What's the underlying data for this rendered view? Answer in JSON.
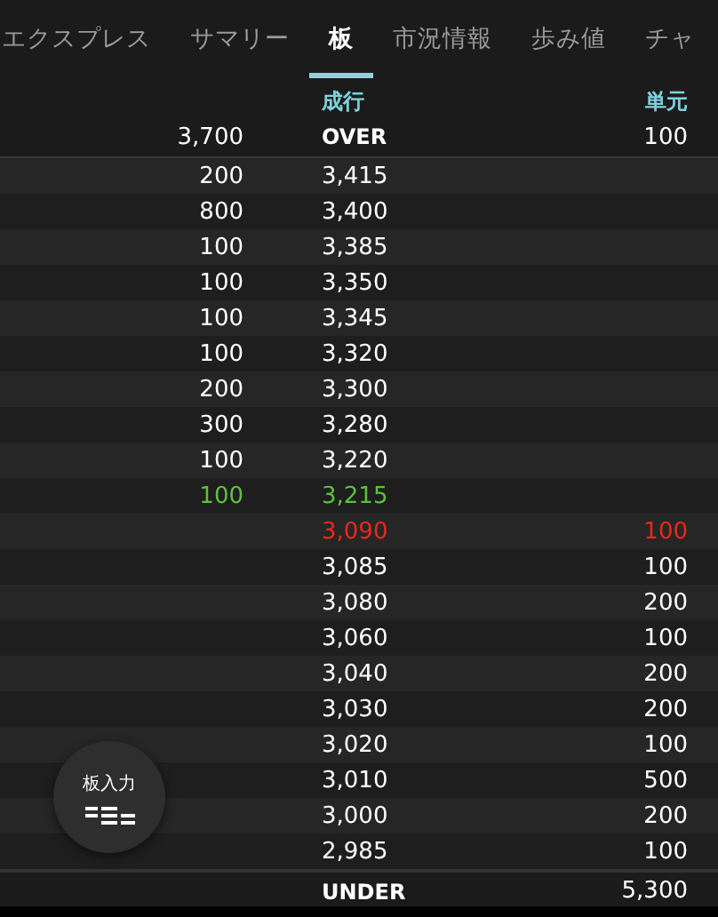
{
  "tabs": [
    {
      "label": "エクスプレス",
      "selected": false
    },
    {
      "label": "サマリー",
      "selected": false
    },
    {
      "label": "板",
      "selected": true
    },
    {
      "label": "市況情報",
      "selected": false
    },
    {
      "label": "歩み値",
      "selected": false
    },
    {
      "label": "チャ",
      "selected": false
    }
  ],
  "board": {
    "header": {
      "price": "成行",
      "buy": "単元"
    },
    "over": {
      "sell": "3,700",
      "price": "OVER",
      "buy": "100"
    },
    "rows": [
      {
        "sell": "200",
        "price": "3,415",
        "color": "#ffffff"
      },
      {
        "sell": "800",
        "price": "3,400",
        "color": "#ffffff"
      },
      {
        "sell": "100",
        "price": "3,385",
        "color": "#ffffff"
      },
      {
        "sell": "100",
        "price": "3,350",
        "color": "#ffffff"
      },
      {
        "sell": "100",
        "price": "3,345",
        "color": "#ffffff"
      },
      {
        "sell": "100",
        "price": "3,320",
        "color": "#ffffff"
      },
      {
        "sell": "200",
        "price": "3,300",
        "color": "#ffffff"
      },
      {
        "sell": "300",
        "price": "3,280",
        "color": "#ffffff"
      },
      {
        "sell": "100",
        "price": "3,220",
        "color": "#ffffff"
      },
      {
        "sell": "100",
        "price": "3,215",
        "color": "#5cc23c"
      },
      {
        "price": "3,090",
        "buy": "100",
        "color": "#e8291c"
      },
      {
        "price": "3,085",
        "buy": "100",
        "color": "#ffffff"
      },
      {
        "price": "3,080",
        "buy": "200",
        "color": "#ffffff"
      },
      {
        "price": "3,060",
        "buy": "100",
        "color": "#ffffff"
      },
      {
        "price": "3,040",
        "buy": "200",
        "color": "#ffffff"
      },
      {
        "price": "3,030",
        "buy": "200",
        "color": "#ffffff"
      },
      {
        "price": "3,020",
        "buy": "100",
        "color": "#ffffff"
      },
      {
        "price": "3,010",
        "buy": "500",
        "color": "#ffffff"
      },
      {
        "price": "3,000",
        "buy": "200",
        "color": "#ffffff"
      },
      {
        "price": "2,985",
        "buy": "100",
        "color": "#ffffff"
      }
    ],
    "under": {
      "price": "UNDER",
      "buy": "5,300"
    }
  },
  "fab": {
    "label": "板入力"
  }
}
